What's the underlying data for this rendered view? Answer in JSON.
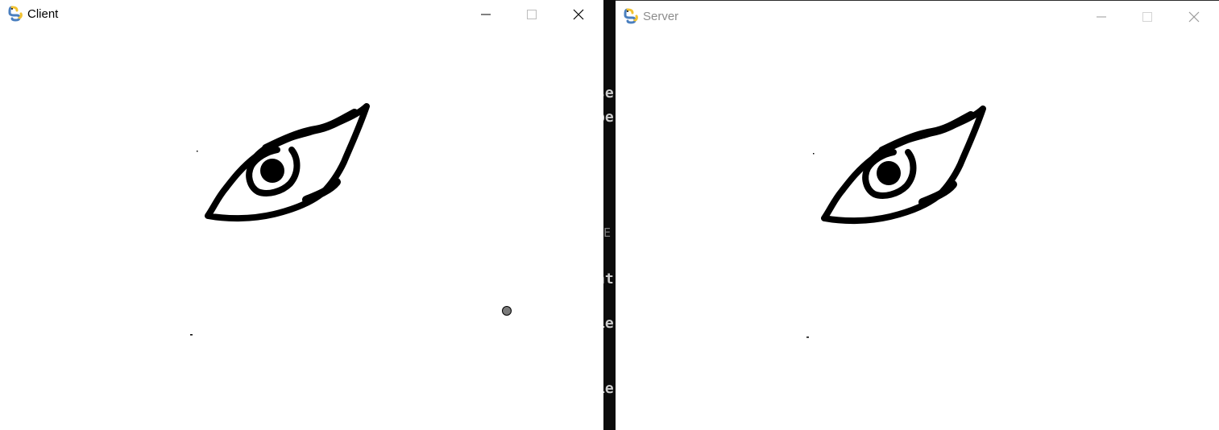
{
  "client_window": {
    "title": "Client",
    "icon": "pygame-snake-icon",
    "controls": [
      "minimize",
      "maximize",
      "close"
    ],
    "drawing": "eye-sketch"
  },
  "server_window": {
    "title": "Server",
    "icon": "pygame-snake-icon",
    "controls": [
      "minimize",
      "maximize",
      "close"
    ],
    "drawing": "eye-sketch",
    "state": "inactive"
  },
  "terminal_fragments": [
    "se",
    "pe",
    "ME",
    "ht",
    "ie",
    "ie"
  ],
  "colors": {
    "ink": "#000000",
    "canvas": "#ffffff",
    "terminal_bg": "#0c0c0c",
    "cursor_dot": "#7a7a7a"
  }
}
